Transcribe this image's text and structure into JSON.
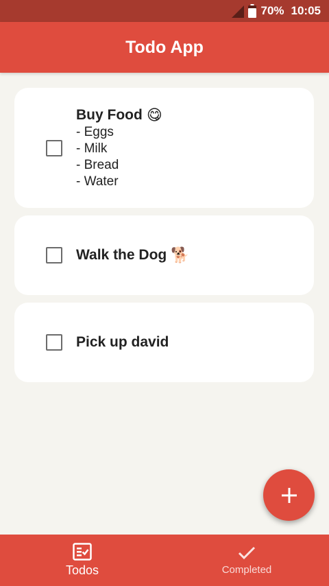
{
  "status_bar": {
    "battery": "70%",
    "time": "10:05"
  },
  "app_bar": {
    "title": "Todo App"
  },
  "todos": [
    {
      "title": "Buy Food",
      "emoji": "😋",
      "body": "- Eggs\n- Milk\n- Bread\n- Water",
      "checked": false
    },
    {
      "title": "Walk the Dog",
      "emoji": "🐕",
      "body": "",
      "checked": false
    },
    {
      "title": "Pick up david",
      "emoji": "",
      "body": "",
      "checked": false
    }
  ],
  "fab": {
    "icon": "plus-icon"
  },
  "bottom_nav": {
    "items": [
      {
        "label": "Todos",
        "icon": "todo-list-icon",
        "active": true
      },
      {
        "label": "Completed",
        "icon": "check-icon",
        "active": false
      }
    ]
  },
  "colors": {
    "primary": "#df4c3e",
    "status_bar": "#a63a2e",
    "background": "#f5f4ef"
  }
}
